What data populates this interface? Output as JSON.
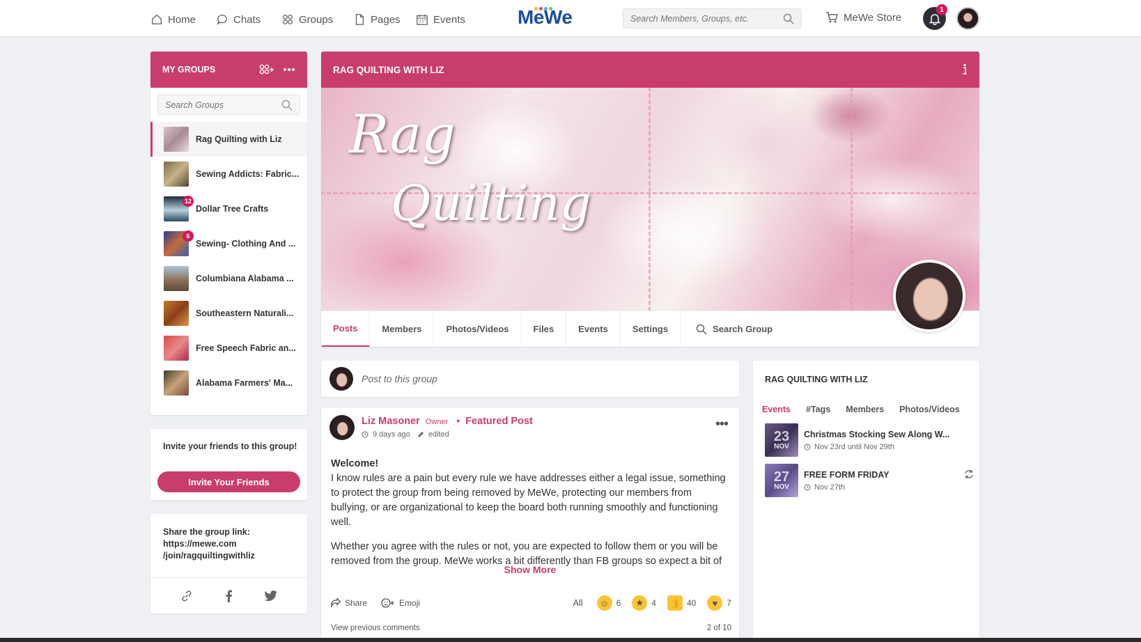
{
  "nav": {
    "items": [
      {
        "label": "Home",
        "icon": "home-icon"
      },
      {
        "label": "Chats",
        "icon": "chat-icon"
      },
      {
        "label": "Groups",
        "icon": "groups-icon"
      },
      {
        "label": "Pages",
        "icon": "page-icon"
      },
      {
        "label": "Events",
        "icon": "calendar-icon"
      }
    ],
    "logo": "MeWe",
    "search_placeholder": "Search Members, Groups, etc.",
    "store_label": "MeWe Store",
    "notification_count": "1"
  },
  "my_groups": {
    "title": "MY GROUPS",
    "search_placeholder": "Search Groups",
    "groups": [
      {
        "name": "Rag Quilting with Liz",
        "badge": ""
      },
      {
        "name": "Sewing Addicts: Fabric...",
        "badge": ""
      },
      {
        "name": "Dollar Tree Crafts",
        "badge": "12"
      },
      {
        "name": "Sewing- Clothing And ...",
        "badge": "6"
      },
      {
        "name": "Columbiana Alabama ...",
        "badge": ""
      },
      {
        "name": "Southeastern Naturali...",
        "badge": ""
      },
      {
        "name": "Free Speech Fabric an...",
        "badge": ""
      },
      {
        "name": "Alabama Farmers' Ma...",
        "badge": ""
      }
    ]
  },
  "invite": {
    "text": "Invite your friends to this group!",
    "button": "Invite Your Friends"
  },
  "share": {
    "label": "Share the group link:",
    "link_line1": "https://mewe.com",
    "link_line2": "/join/ragquiltingwithliz"
  },
  "group": {
    "title": "RAG QUILTING WITH LIZ",
    "cover_text_line1": "Rag",
    "cover_text_line2": "Quilting",
    "tabs": [
      "Posts",
      "Members",
      "Photos/Videos",
      "Files",
      "Events",
      "Settings"
    ],
    "search_tab": "Search Group"
  },
  "composer": {
    "placeholder": "Post to this group"
  },
  "post": {
    "author": "Liz Masoner",
    "role": "Owner",
    "featured": "Featured Post",
    "time": "9 days ago",
    "edited": "edited",
    "heading": "Welcome!",
    "para1": "I know rules are a pain but every rule we have addresses either a legal issue, something to protect the group from being removed by MeWe, protecting our members from bullying, or are organizational to keep the board both running smoothly and functioning well.",
    "para2": "Whether you agree with the rules or not, you are expected to follow them or you will be removed from the group. MeWe works a bit differently than FB groups so expect a bit of",
    "show_more": "Show More",
    "share_label": "Share",
    "emoji_label": "Emoji",
    "all_label": "All",
    "reactions": [
      {
        "icon": "smile-emoji-icon",
        "count": "6"
      },
      {
        "icon": "star-eyes-emoji-icon",
        "count": "4"
      },
      {
        "icon": "thumbs-up-emoji-icon",
        "count": "40"
      },
      {
        "icon": "hug-emoji-icon",
        "count": "7"
      }
    ],
    "prev_comments": "View previous comments",
    "comment_count": "2 of 10"
  },
  "right_panel": {
    "title": "RAG QUILTING WITH LIZ",
    "tabs": [
      "Events",
      "#Tags",
      "Members",
      "Photos/Videos"
    ],
    "events": [
      {
        "day": "23",
        "month": "NOV",
        "name": "Christmas Stocking Sew Along W...",
        "date": "Nov 23rd until Nov 29th",
        "thumb_color": "#6b5a8a"
      },
      {
        "day": "27",
        "month": "NOV",
        "name": "FREE FORM FRIDAY",
        "date": "Nov 27th",
        "thumb_color": "#8a7bb5"
      }
    ]
  },
  "colors": {
    "accent": "#c93d6e",
    "badge": "#d3195a"
  }
}
